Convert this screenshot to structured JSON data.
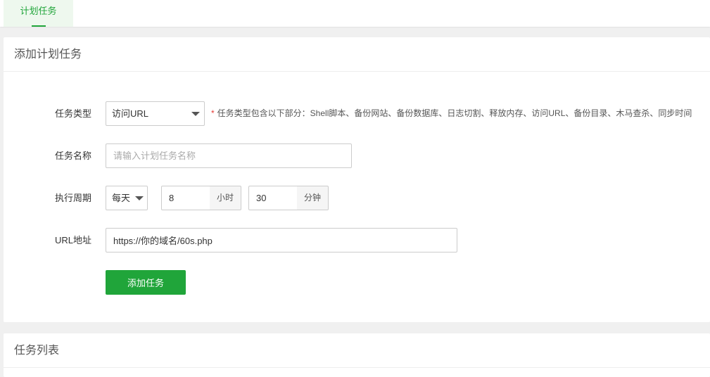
{
  "tabs": [
    {
      "label": "计划任务",
      "active": true
    }
  ],
  "add_panel": {
    "title": "添加计划任务",
    "task_type": {
      "label": "任务类型",
      "selected": "访问URL",
      "hint_star": "*",
      "hint": "任务类型包含以下部分：Shell脚本、备份网站、备份数据库、日志切割、释放内存、访问URL、备份目录、木马查杀、同步时间"
    },
    "task_name": {
      "label": "任务名称",
      "value": "",
      "placeholder": "请输入计划任务名称"
    },
    "cycle": {
      "label": "执行周期",
      "period_selected": "每天",
      "hour_value": "8",
      "hour_unit": "小时",
      "minute_value": "30",
      "minute_unit": "分钟"
    },
    "url": {
      "label": "URL地址",
      "value": "https://你的域名/60s.php"
    },
    "submit_label": "添加任务"
  },
  "list_panel": {
    "title": "任务列表"
  },
  "colors": {
    "accent": "#20a53a",
    "required": "#e53935"
  }
}
